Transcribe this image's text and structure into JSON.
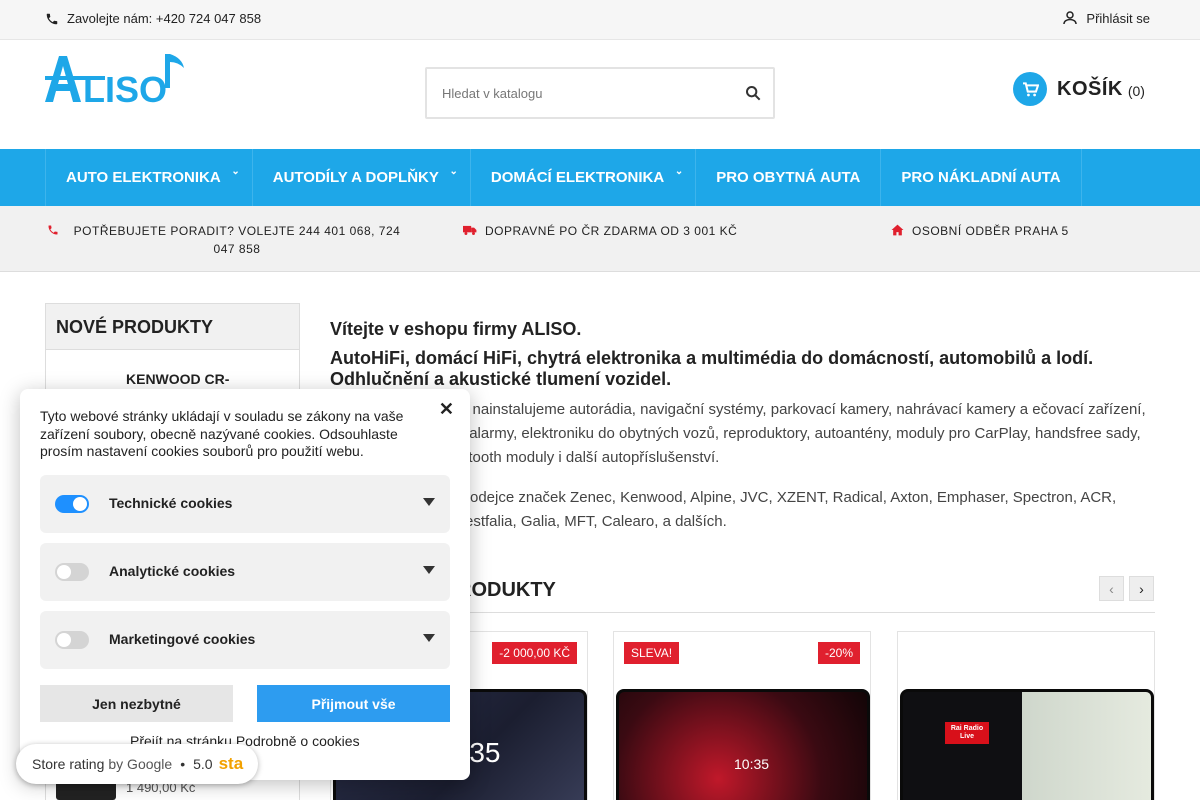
{
  "topbar": {
    "call_text": "Zavolejte nám: +420 724 047 858",
    "login_text": "Přihlásit se"
  },
  "header": {
    "logo_text": "ALISO",
    "search_placeholder": "Hledat v katalogu",
    "cart_label": "KOŠÍK",
    "cart_count": "(0)"
  },
  "nav": {
    "items": [
      {
        "label": "AUTO ELEKTRONIKA"
      },
      {
        "label": "AUTODÍLY A DOPLŇKY"
      },
      {
        "label": "DOMÁCÍ ELEKTRONIKA"
      },
      {
        "label": "PRO OBYTNÁ AUTA"
      },
      {
        "label": "PRO NÁKLADNÍ AUTA"
      }
    ]
  },
  "strip": {
    "advice": "POTŘEBUJETE PORADIT? VOLEJTE 244 401 068, 724 047 858",
    "shipping": "DOPRAVNÉ PO ČR ZDARMA OD 3 001 KČ",
    "pickup": "OSOBNÍ ODBĚR PRAHA 5"
  },
  "new_products": {
    "title": "NOVÉ PRODUKTY",
    "first_name": "KENWOOD CR-",
    "last_price": "1 490,00 Kč"
  },
  "welcome": {
    "h1": "Vítejte v eshopu firmy ALISO.",
    "h2": "AutoHiFi, domácí HiFi, chytrá elektronika a multimédia do domácností, automobilů a lodí. Odhlučnění a akustické tlumení vozidel.",
    "p1": "álně nainstalujeme autorádia, navigační systémy, parkovací kamery, nahrávací kamery a ečovací zařízení, autoalarmy, elektroniku do obytných vozů, reproduktory, autoantény, moduly pro CarPlay, handsfree sady, bluetooth moduly i další autopříslušenství.",
    "p2": "rodejce značek Zenec, Kenwood, Alpine, JVC, XZENT, Radical, Axton, Emphaser, Spectron, ACR, estfalia, Galia, MFT, Calearo, a dalších."
  },
  "section": {
    "title": "RODUKTY",
    "prev": "‹",
    "next": "›"
  },
  "cards": [
    {
      "badge_right": "-2 000,00 KČ",
      "clock": "0:35"
    },
    {
      "badge_left": "SLEVA!",
      "badge_right": "-20%",
      "clock": "10:35"
    },
    {
      "screen_label": "Rai Radio Live"
    }
  ],
  "cookies": {
    "intro": "Tyto webové stránky ukládají v souladu se zákony na vaše zařízení soubory, obecně nazývané cookies. Odsouhlaste prosím nastavení cookies souborů pro použití webu.",
    "close": "✕",
    "rows": [
      {
        "label": "Technické cookies"
      },
      {
        "label": "Analytické cookies"
      },
      {
        "label": "Marketingové cookies"
      }
    ],
    "btn_necessary": "Jen nezbytné",
    "btn_accept": "Přijmout vše",
    "link": "Přejít na stránku Podrobně o cookies"
  },
  "rating": {
    "label": "Store rating",
    "by": "by Google",
    "score": "5.0",
    "stars": "sta"
  },
  "colors": {
    "accent": "#1ea7e8",
    "badge": "#e0202e",
    "toggle_on": "#1e90ff"
  }
}
